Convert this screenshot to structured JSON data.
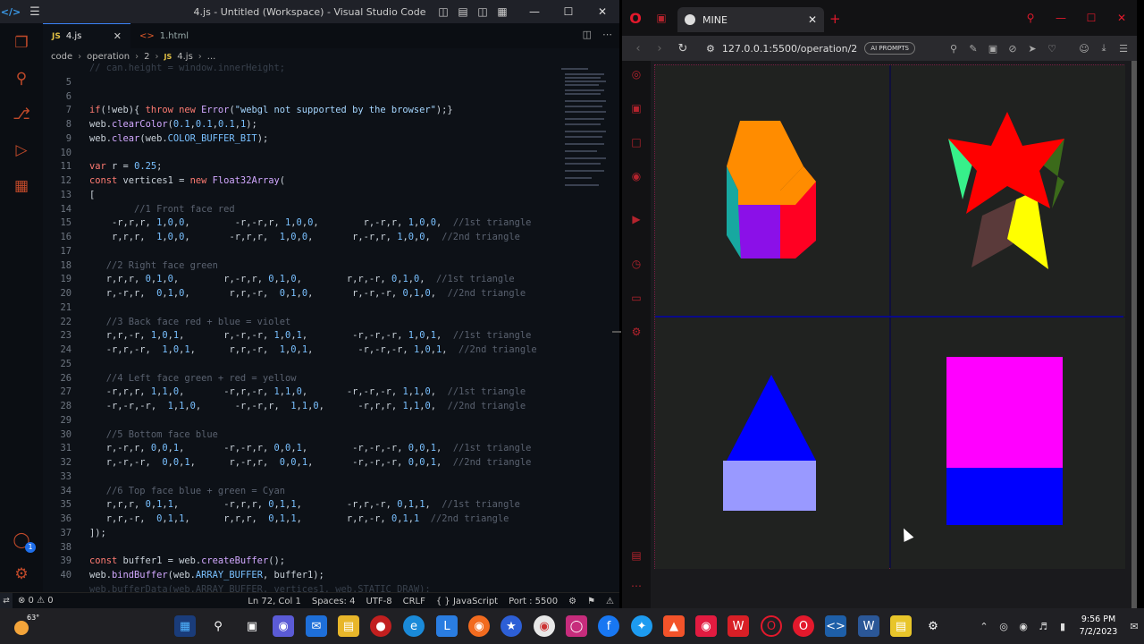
{
  "vscode": {
    "window_title": "4.js - Untitled (Workspace) - Visual Studio Code",
    "tabs": [
      {
        "label": "4.js",
        "badge": "JS"
      },
      {
        "label": "1.html",
        "badge": "<>"
      }
    ],
    "breadcrumb": [
      "code",
      "operation",
      "2",
      "4.js",
      "..."
    ],
    "lines": [
      {
        "n": "",
        "t": "// can.height = window.innerHeight;",
        "cls": "dim"
      },
      {
        "n": "5",
        "t": ""
      },
      {
        "n": "6",
        "t": ""
      },
      {
        "n": "7",
        "t": "if(!web){ throw new Error(\"webgl not supported by the browser\");}"
      },
      {
        "n": "8",
        "t": "web.clearColor(0.1,0.1,0.1,1);"
      },
      {
        "n": "9",
        "t": "web.clear(web.COLOR_BUFFER_BIT);"
      },
      {
        "n": "10",
        "t": ""
      },
      {
        "n": "11",
        "t": "var r = 0.25;"
      },
      {
        "n": "12",
        "t": "const vertices1 = new Float32Array("
      },
      {
        "n": "13",
        "t": "["
      },
      {
        "n": "14",
        "t": "        //1 Front face red",
        "cls": "cmt"
      },
      {
        "n": "15",
        "t": "    -r,r,r, 1,0,0,        -r,-r,r, 1,0,0,        r,-r,r, 1,0,0,  //1st triangle"
      },
      {
        "n": "16",
        "t": "    r,r,r,  1,0,0,       -r,r,r,  1,0,0,       r,-r,r, 1,0,0,  //2nd triangle"
      },
      {
        "n": "17",
        "t": ""
      },
      {
        "n": "18",
        "t": "   //2 Right face green",
        "cls": "cmt"
      },
      {
        "n": "19",
        "t": "   r,r,r, 0,1,0,        r,-r,r, 0,1,0,        r,r,-r, 0,1,0,  //1st triangle"
      },
      {
        "n": "20",
        "t": "   r,-r,r,  0,1,0,       r,r,-r,  0,1,0,       r,-r,-r, 0,1,0,  //2nd triangle"
      },
      {
        "n": "21",
        "t": ""
      },
      {
        "n": "22",
        "t": "   //3 Back face red + blue = violet",
        "cls": "cmt"
      },
      {
        "n": "23",
        "t": "   r,r,-r, 1,0,1,       r,-r,-r, 1,0,1,        -r,-r,-r, 1,0,1,  //1st triangle"
      },
      {
        "n": "24",
        "t": "   -r,r,-r,  1,0,1,      r,r,-r,  1,0,1,        -r,-r,-r, 1,0,1,  //2nd triangle"
      },
      {
        "n": "25",
        "t": ""
      },
      {
        "n": "26",
        "t": "   //4 Left face green + red = yellow",
        "cls": "cmt"
      },
      {
        "n": "27",
        "t": "   -r,r,r, 1,1,0,       -r,r,-r, 1,1,0,       -r,-r,-r, 1,1,0,  //1st triangle"
      },
      {
        "n": "28",
        "t": "   -r,-r,-r,  1,1,0,      -r,-r,r,  1,1,0,      -r,r,r, 1,1,0,  //2nd triangle"
      },
      {
        "n": "29",
        "t": ""
      },
      {
        "n": "30",
        "t": "   //5 Bottom face blue",
        "cls": "cmt"
      },
      {
        "n": "31",
        "t": "   r,-r,r, 0,0,1,       -r,-r,r, 0,0,1,        -r,-r,-r, 0,0,1,  //1st triangle"
      },
      {
        "n": "32",
        "t": "   r,-r,-r,  0,0,1,      r,-r,r,  0,0,1,       -r,-r,-r, 0,0,1,  //2nd triangle"
      },
      {
        "n": "33",
        "t": ""
      },
      {
        "n": "34",
        "t": "   //6 Top face blue + green = Cyan",
        "cls": "cmt"
      },
      {
        "n": "35",
        "t": "   r,r,r, 0,1,1,        -r,r,r, 0,1,1,        -r,r,-r, 0,1,1,  //1st triangle"
      },
      {
        "n": "36",
        "t": "   r,r,-r,  0,1,1,      r,r,r,  0,1,1,        r,r,-r, 0,1,1  //2nd triangle"
      },
      {
        "n": "37",
        "t": "]);"
      },
      {
        "n": "38",
        "t": ""
      },
      {
        "n": "39",
        "t": "const buffer1 = web.createBuffer();"
      },
      {
        "n": "40",
        "t": "web.bindBuffer(web.ARRAY_BUFFER, buffer1);"
      },
      {
        "n": "",
        "t": "web.bufferData(web.ARRAY_BUFFER, vertices1, web.STATIC_DRAW);",
        "cls": "dim"
      }
    ],
    "status": {
      "problems": "⊗ 0 ⚠ 0",
      "position": "Ln 72, Col 1",
      "spaces": "Spaces: 4",
      "encoding": "UTF-8",
      "eol": "CRLF",
      "language": "{ } JavaScript",
      "port": "Port : 5500"
    }
  },
  "browser": {
    "tab_title": "MINE",
    "url": "127.0.0.1:5500/operation/2",
    "ai_prompts": "AI PROMPTS"
  },
  "taskbar": {
    "weather_temp": "63°",
    "time": "9:56 PM",
    "date": "7/2/2023"
  },
  "colors": {
    "orange": "#ff8c00",
    "teal": "#17a8a0",
    "violet": "#8b10e8",
    "red": "#ff0022",
    "green_light": "#37f08a",
    "red_star": "#ff0000",
    "olive": "#3b6a1a",
    "brown": "#5a3a3a",
    "yellow": "#ffff00",
    "blue": "#0000ff",
    "lavender": "#9999ff",
    "magenta": "#ff00ff"
  }
}
